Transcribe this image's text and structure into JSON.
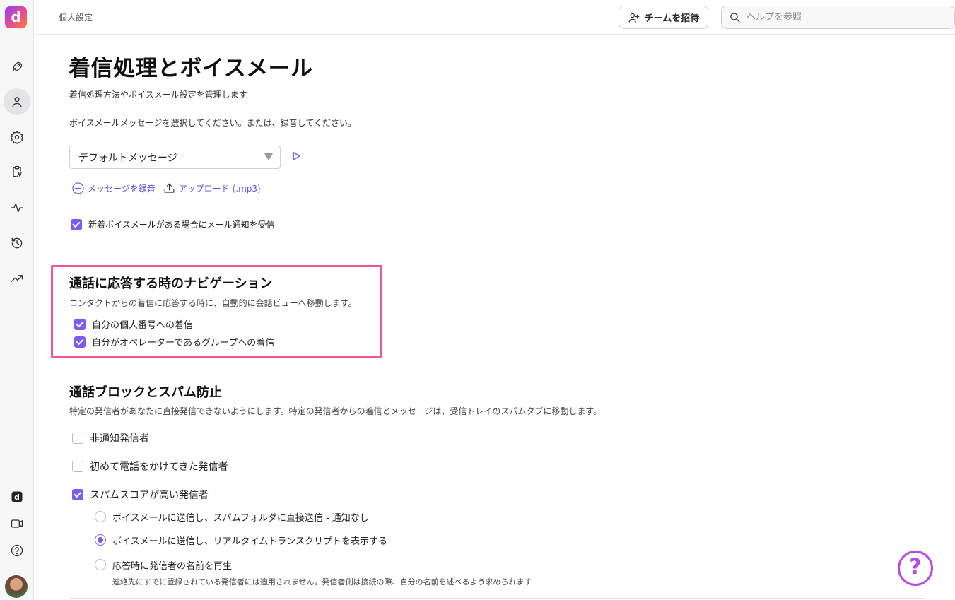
{
  "app": {
    "logo_letter": "d"
  },
  "rail": {
    "items": [
      {
        "icon": "rocket-icon"
      },
      {
        "icon": "person-icon",
        "active": true
      },
      {
        "icon": "gear-icon"
      },
      {
        "icon": "clipboard-icon"
      },
      {
        "icon": "activity-icon"
      },
      {
        "icon": "history-icon"
      },
      {
        "icon": "trending-icon"
      }
    ],
    "bottom": [
      {
        "icon": "brand-app-icon"
      },
      {
        "icon": "video-icon"
      },
      {
        "icon": "help-circle-icon"
      }
    ]
  },
  "topbar": {
    "breadcrumb": "個人設定",
    "invite_label": "チームを招待",
    "search_placeholder": "ヘルプを参照"
  },
  "page": {
    "title": "着信処理とボイスメール",
    "subtitle": "着信処理方法やボイスメール設定を管理します"
  },
  "voicemail": {
    "prompt": "ボイスメールメッセージを選択してください。または、録音してください。",
    "selected_message": "デフォルトメッセージ",
    "record_label": "メッセージを録音",
    "upload_label": "アップロード (.mp3)",
    "email_notify_label": "新着ボイスメールがある場合にメール通知を受信",
    "email_notify_checked": true
  },
  "navigation": {
    "title": "通話に応答する時のナビゲーション",
    "description": "コンタクトからの着信に応答する時に、自動的に会話ビューへ移動します。",
    "options": [
      {
        "label": "自分の個人番号への着信",
        "checked": true
      },
      {
        "label": "自分がオペレーターであるグループへの着信",
        "checked": true
      }
    ]
  },
  "blocking": {
    "title": "通話ブロックとスパム防止",
    "description": "特定の発信者があなたに直接発信できないようにします。特定の発信者からの着信とメッセージは、受信トレイのスパムタブに移動します。",
    "options": [
      {
        "label": "非通知発信者",
        "checked": false
      },
      {
        "label": "初めて電話をかけてきた発信者",
        "checked": false
      },
      {
        "label": "スパムスコアが高い発信者",
        "checked": true
      }
    ],
    "spam_actions": [
      {
        "label": "ボイスメールに送信し、スパムフォルダに直接送信 - 通知なし",
        "selected": false,
        "sub": ""
      },
      {
        "label": "ボイスメールに送信し、リアルタイムトランスクリプトを表示する",
        "selected": true,
        "sub": ""
      },
      {
        "label": "応答時に発信者の名前を再生",
        "selected": false,
        "sub": "連絡先にすでに登録されている発信者には適用されません。発信者側は接続の際、自分の名前を述べるよう求められます"
      }
    ]
  },
  "help_fab_label": "?",
  "colors": {
    "accent": "#7b5cf0",
    "highlight": "#f0588a",
    "fab": "#b44ae8"
  }
}
